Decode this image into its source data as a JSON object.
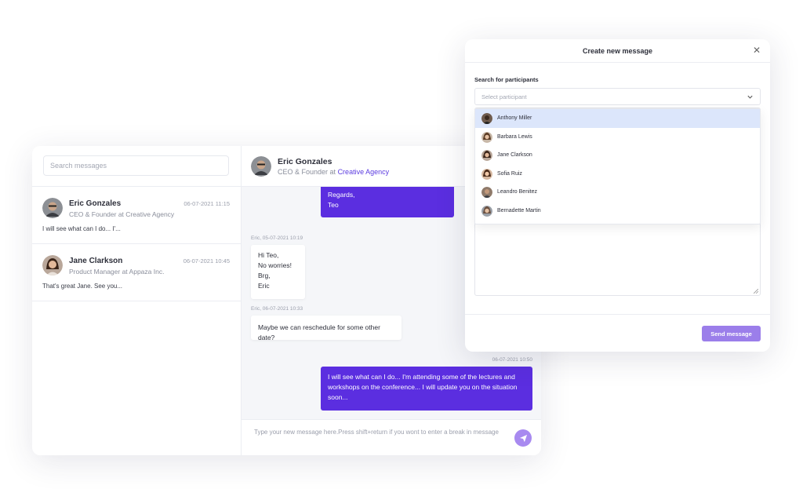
{
  "sidebar": {
    "search_placeholder": "Search messages",
    "conversations": [
      {
        "name": "Eric Gonzales",
        "role": "CEO & Founder at Creative Agency",
        "time": "06-07-2021 11:15",
        "preview": "I will see what can I do... I'..."
      },
      {
        "name": "Jane Clarkson",
        "role": "Product Manager at Appaza Inc.",
        "time": "06-07-2021 10:45",
        "preview": "That's great Jane. See you..."
      }
    ]
  },
  "chat": {
    "header": {
      "name": "Eric Gonzales",
      "role_prefix": "CEO & Founder at",
      "company": "Creative Agency"
    },
    "messages": [
      {
        "direction": "out",
        "lines": [
          "Regards,",
          "Teo"
        ]
      },
      {
        "direction": "in",
        "meta": "Eric, 05-07-2021 10:19",
        "lines": [
          "Hi Teo,",
          "No worries!",
          "Brg,",
          "Eric"
        ]
      },
      {
        "direction": "in",
        "meta": "Eric, 06-07-2021 10:33",
        "lines": [
          "Maybe we can reschedule for some other date?"
        ]
      },
      {
        "direction": "out",
        "meta": "06-07-2021 10:50",
        "lines": [
          "I will see what can I do... I'm attending some of the lectures and",
          "workshops on the conference... I will update you on the situation",
          "soon..."
        ]
      }
    ],
    "composer_placeholder": "Type your new message here.Press shift+return if you wont to enter a break in message"
  },
  "modal": {
    "title": "Create new message",
    "field_label": "Search for participants",
    "select_placeholder": "Select participant",
    "options": [
      "Anthony Miller",
      "Barbara Lewis",
      "Jane Clarkson",
      "Sofia Ruiz",
      "Leandro Benitez",
      "Bernadette Martin"
    ],
    "send_label": "Send message"
  },
  "colors": {
    "accent": "#5b2ee0",
    "accent_light": "#9b7eea",
    "highlight": "#dce6fb"
  },
  "icons": {
    "close": "close-icon",
    "chevron": "chevron-down-icon",
    "send": "paper-plane-icon"
  }
}
